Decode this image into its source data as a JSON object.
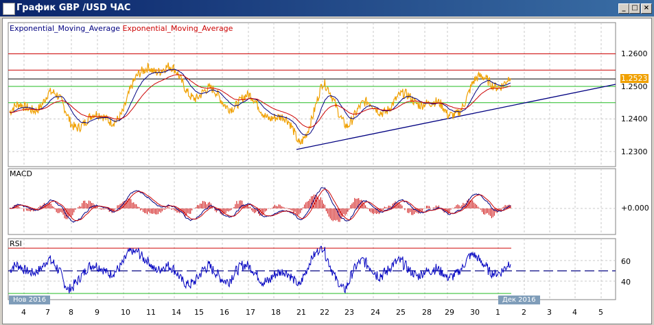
{
  "window": {
    "title": "График GBP /USD  ЧАС",
    "minimize": "_",
    "restore": "□",
    "close": "×"
  },
  "legend": {
    "ema1": "Exponential_Moving_Average",
    "ema2": "Exponential_Moving_Average",
    "ema1_color": "#000080",
    "ema2_color": "#cc0000"
  },
  "price_axis": [
    "1.2600",
    "1.2500",
    "1.2400",
    "1.2300"
  ],
  "current_price": "1.2523",
  "macd": {
    "label": "MACD",
    "axis": "+0.000"
  },
  "rsi": {
    "label": "RSI",
    "axis": [
      "60",
      "40"
    ]
  },
  "date_axis": {
    "month1": "Нов 2016",
    "month2": "Дек 2016",
    "days": [
      "4",
      "7",
      "8",
      "9",
      "10",
      "11",
      "14",
      "15",
      "16",
      "17",
      "18",
      "21",
      "22",
      "23",
      "24",
      "25",
      "28",
      "29",
      "30",
      "1",
      "2",
      "3",
      "4",
      "5"
    ]
  },
  "chart_data": {
    "type": "line",
    "series": [
      {
        "name": "GBP/USD",
        "x": [
          "4",
          "7",
          "8",
          "9",
          "10",
          "11",
          "14",
          "15",
          "16",
          "17",
          "18",
          "21",
          "22",
          "23",
          "24",
          "25",
          "28",
          "29",
          "30",
          "1"
        ],
        "values": [
          1.242,
          1.248,
          1.24,
          1.239,
          1.243,
          1.258,
          1.253,
          1.248,
          1.246,
          1.245,
          1.242,
          1.233,
          1.249,
          1.24,
          1.244,
          1.245,
          1.247,
          1.24,
          1.25,
          1.2523
        ]
      }
    ],
    "horizontal_levels": [
      1.26,
      1.255,
      1.2523,
      1.25,
      1.245
    ],
    "trendline": [
      [
        "21",
        1.231
      ],
      [
        "5",
        1.251
      ]
    ],
    "ylim": [
      1.227,
      1.27
    ]
  }
}
